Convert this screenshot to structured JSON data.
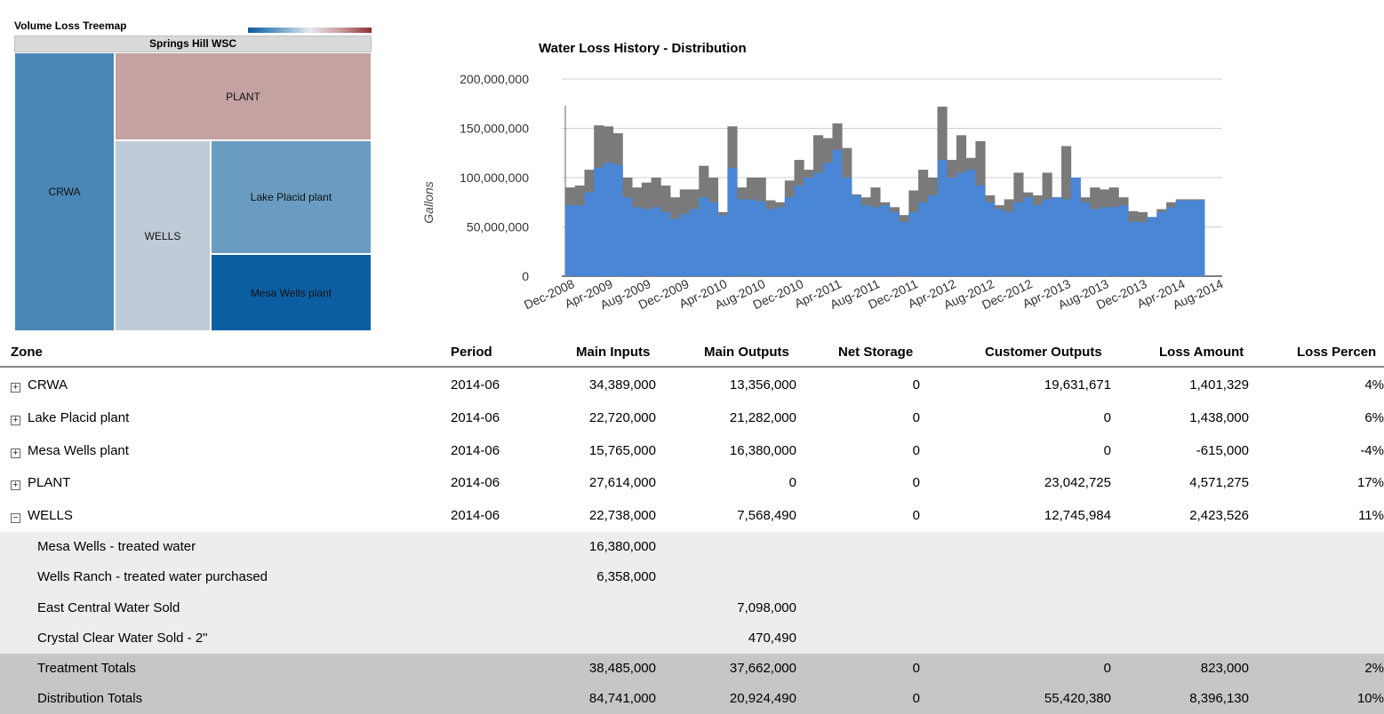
{
  "treemap": {
    "title": "Volume Loss Treemap",
    "root": "Springs Hill WSC",
    "cells": [
      {
        "label": "CRWA",
        "color": "#4a86b6"
      },
      {
        "label": "PLANT",
        "color": "#c4a2a2"
      },
      {
        "label": "WELLS",
        "color": "#bfcbd6"
      },
      {
        "label": "Lake Placid plant",
        "color": "#6a9cc2"
      },
      {
        "label": "Mesa Wells plant",
        "color": "#0c5ea3"
      }
    ]
  },
  "chart_data": {
    "type": "area",
    "title": "Water Loss History - Distribution",
    "ylabel": "Gallons",
    "xlabel": "",
    "ylim": [
      0,
      200000000
    ],
    "yticks": [
      "0",
      "50,000,000",
      "100,000,000",
      "150,000,000",
      "200,000,000"
    ],
    "xtick_labels": [
      "Dec-2008",
      "Apr-2009",
      "Aug-2009",
      "Dec-2009",
      "Apr-2010",
      "Aug-2010",
      "Dec-2010",
      "Apr-2011",
      "Aug-2011",
      "Dec-2011",
      "Apr-2012",
      "Aug-2012",
      "Dec-2012",
      "Apr-2013",
      "Aug-2013",
      "Dec-2013",
      "Apr-2014",
      "Aug-2014"
    ],
    "x": [
      "Dec-2008",
      "Jan-2009",
      "Feb-2009",
      "Mar-2009",
      "Apr-2009",
      "May-2009",
      "Jun-2009",
      "Jul-2009",
      "Aug-2009",
      "Sep-2009",
      "Oct-2009",
      "Nov-2009",
      "Dec-2009",
      "Jan-2010",
      "Feb-2010",
      "Mar-2010",
      "Apr-2010",
      "May-2010",
      "Jun-2010",
      "Jul-2010",
      "Aug-2010",
      "Sep-2010",
      "Oct-2010",
      "Nov-2010",
      "Dec-2010",
      "Jan-2011",
      "Feb-2011",
      "Mar-2011",
      "Apr-2011",
      "May-2011",
      "Jun-2011",
      "Jul-2011",
      "Aug-2011",
      "Sep-2011",
      "Oct-2011",
      "Nov-2011",
      "Dec-2011",
      "Jan-2012",
      "Feb-2012",
      "Mar-2012",
      "Apr-2012",
      "May-2012",
      "Jun-2012",
      "Jul-2012",
      "Aug-2012",
      "Sep-2012",
      "Oct-2012",
      "Nov-2012",
      "Dec-2012",
      "Jan-2013",
      "Feb-2013",
      "Mar-2013",
      "Apr-2013",
      "May-2013",
      "Jun-2013",
      "Jul-2013",
      "Aug-2013",
      "Sep-2013",
      "Oct-2013",
      "Nov-2013",
      "Dec-2013",
      "Jan-2014",
      "Feb-2014",
      "Mar-2014",
      "Apr-2014",
      "May-2014",
      "Jun-2014"
    ],
    "series": [
      {
        "color": "#4a86d6",
        "values": [
          72000000,
          72000000,
          85000000,
          110000000,
          115000000,
          113000000,
          80000000,
          70000000,
          68000000,
          70000000,
          65000000,
          58000000,
          63000000,
          68000000,
          80000000,
          75000000,
          62000000,
          110000000,
          78000000,
          78000000,
          76000000,
          68000000,
          70000000,
          80000000,
          92000000,
          100000000,
          105000000,
          115000000,
          128000000,
          100000000,
          82000000,
          72000000,
          70000000,
          72000000,
          65000000,
          55000000,
          65000000,
          75000000,
          82000000,
          118000000,
          100000000,
          105000000,
          108000000,
          92000000,
          75000000,
          68000000,
          65000000,
          75000000,
          80000000,
          72000000,
          78000000,
          80000000,
          78000000,
          100000000,
          75000000,
          68000000,
          70000000,
          70000000,
          72000000,
          55000000,
          55000000,
          60000000,
          65000000,
          70000000,
          77000000,
          77000000,
          77000000
        ]
      },
      {
        "color": "#7a7a7a",
        "values": [
          90000000,
          92000000,
          108000000,
          153000000,
          152000000,
          145000000,
          100000000,
          90000000,
          95000000,
          100000000,
          92000000,
          80000000,
          88000000,
          88000000,
          112000000,
          100000000,
          65000000,
          152000000,
          90000000,
          100000000,
          100000000,
          77000000,
          75000000,
          97000000,
          118000000,
          108000000,
          143000000,
          140000000,
          155000000,
          130000000,
          83000000,
          80000000,
          90000000,
          75000000,
          70000000,
          62000000,
          87000000,
          108000000,
          100000000,
          172000000,
          118000000,
          143000000,
          120000000,
          137000000,
          82000000,
          72000000,
          78000000,
          105000000,
          85000000,
          82000000,
          105000000,
          80000000,
          132000000,
          85000000,
          80000000,
          90000000,
          88000000,
          90000000,
          80000000,
          66000000,
          65000000,
          60000000,
          68000000,
          75000000,
          78000000,
          78000000,
          78000000
        ]
      }
    ]
  },
  "table": {
    "headers": {
      "zone": "Zone",
      "period": "Period",
      "main_inputs": "Main Inputs",
      "main_outputs": "Main Outputs",
      "net_storage": "Net Storage",
      "customer_outputs": "Customer Outputs",
      "loss_amount": "Loss Amount",
      "loss_percent": "Loss Percen"
    },
    "rows": [
      {
        "expander": "+",
        "zone": "CRWA",
        "period": "2014-06",
        "main_inputs": "34,389,000",
        "main_outputs": "13,356,000",
        "net_storage": "0",
        "customer_outputs": "19,631,671",
        "loss_amount": "1,401,329",
        "loss_percent": "4%"
      },
      {
        "expander": "+",
        "zone": "Lake Placid plant",
        "period": "2014-06",
        "main_inputs": "22,720,000",
        "main_outputs": "21,282,000",
        "net_storage": "0",
        "customer_outputs": "0",
        "loss_amount": "1,438,000",
        "loss_percent": "6%"
      },
      {
        "expander": "+",
        "zone": "Mesa Wells plant",
        "period": "2014-06",
        "main_inputs": "15,765,000",
        "main_outputs": "16,380,000",
        "net_storage": "0",
        "customer_outputs": "0",
        "loss_amount": "-615,000",
        "loss_percent": "-4%"
      },
      {
        "expander": "+",
        "zone": "PLANT",
        "period": "2014-06",
        "main_inputs": "27,614,000",
        "main_outputs": "0",
        "net_storage": "0",
        "customer_outputs": "23,042,725",
        "loss_amount": "4,571,275",
        "loss_percent": "17%"
      },
      {
        "expander": "−",
        "zone": "WELLS",
        "period": "2014-06",
        "main_inputs": "22,738,000",
        "main_outputs": "7,568,490",
        "net_storage": "0",
        "customer_outputs": "12,745,984",
        "loss_amount": "2,423,526",
        "loss_percent": "11%"
      }
    ],
    "detail_rows": [
      {
        "zone": "Mesa Wells - treated water",
        "main_inputs": "16,380,000",
        "main_outputs": ""
      },
      {
        "zone": "Wells Ranch - treated water purchased",
        "main_inputs": "6,358,000",
        "main_outputs": ""
      },
      {
        "zone": "East Central Water Sold",
        "main_inputs": "",
        "main_outputs": "7,098,000"
      },
      {
        "zone": "Crystal Clear Water Sold - 2\"",
        "main_inputs": "",
        "main_outputs": "470,490"
      }
    ],
    "totals": [
      {
        "zone": "Treatment Totals",
        "main_inputs": "38,485,000",
        "main_outputs": "37,662,000",
        "net_storage": "0",
        "customer_outputs": "0",
        "loss_amount": "823,000",
        "loss_percent": "2%"
      },
      {
        "zone": "Distribution Totals",
        "main_inputs": "84,741,000",
        "main_outputs": "20,924,490",
        "net_storage": "0",
        "customer_outputs": "55,420,380",
        "loss_amount": "8,396,130",
        "loss_percent": "10%"
      }
    ]
  }
}
